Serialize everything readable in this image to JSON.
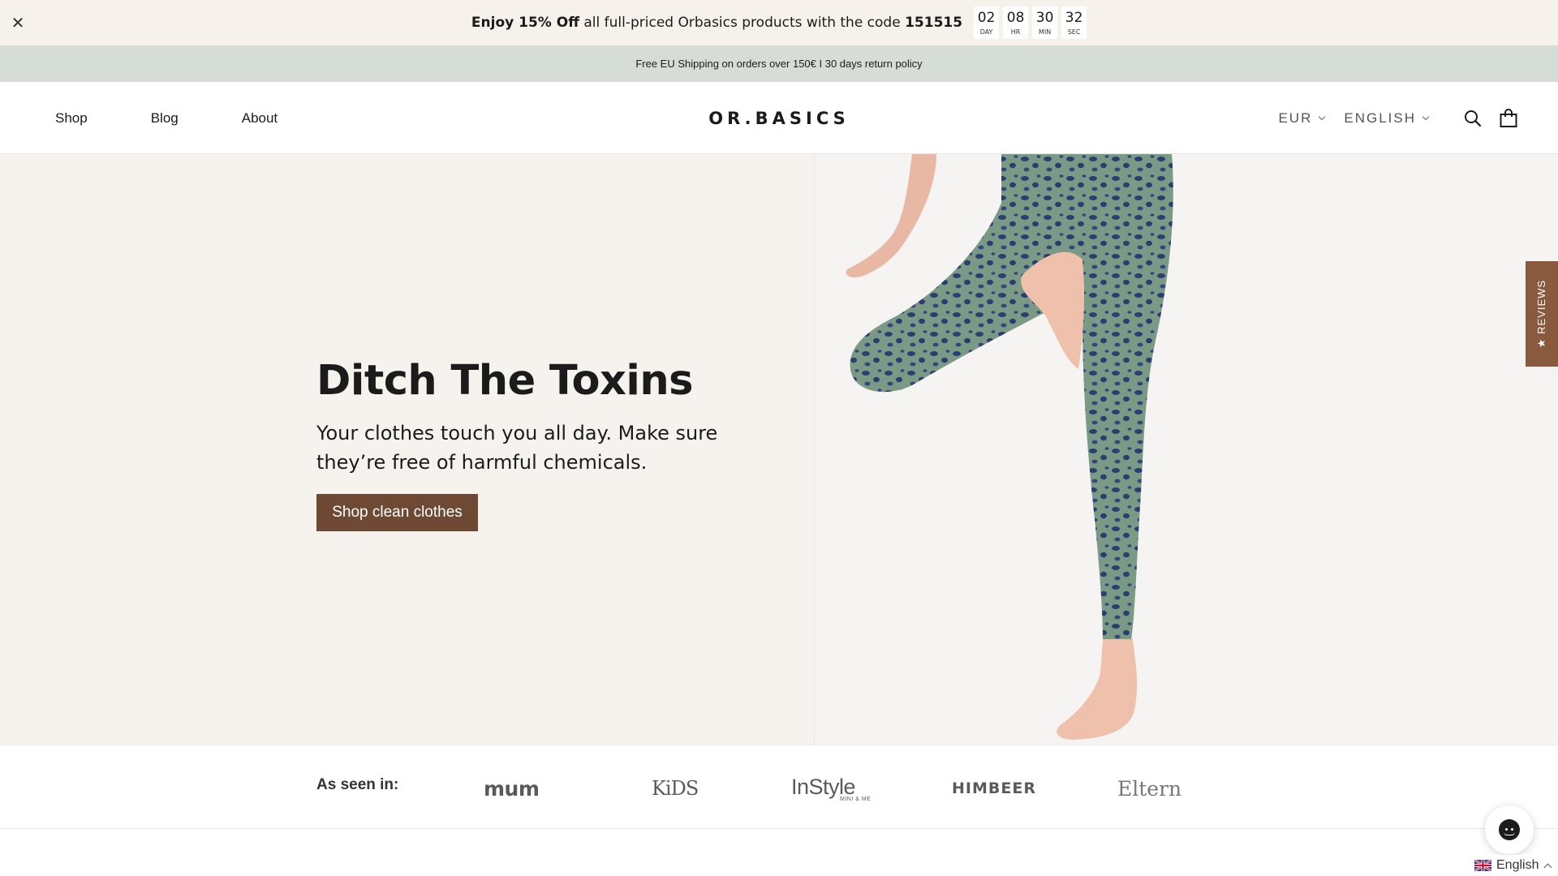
{
  "promo": {
    "text_bold_1": "Enjoy 15% Off",
    "text_mid": " all full-priced Orbasics products with the code ",
    "code": "151515",
    "countdown": [
      {
        "value": "02",
        "label": "DAY"
      },
      {
        "value": "08",
        "label": "HR"
      },
      {
        "value": "30",
        "label": "MIN"
      },
      {
        "value": "32",
        "label": "SEC"
      }
    ]
  },
  "shipping": {
    "text": "Free EU Shipping on orders over 150€ I 30 days return policy"
  },
  "header": {
    "nav": [
      "Shop",
      "Blog",
      "About"
    ],
    "logo": "OR.BASICS",
    "currency": "EUR",
    "language": "ENGLISH"
  },
  "hero": {
    "title": "Ditch The Toxins",
    "subtitle": "Your clothes touch you all day. Make sure they’re free of harmful chemicals.",
    "cta": "Shop clean clothes"
  },
  "reviews_tab": {
    "label": "★ REVIEWS"
  },
  "press": {
    "label": "As seen in:",
    "logos": [
      "mum",
      "KiDS",
      "InStyle",
      "HIMBEER",
      "Eltern"
    ],
    "instyle_sub": "MINI & ME"
  },
  "language_switch": {
    "label": "English"
  },
  "colors": {
    "promo_bg": "#f7f1ec",
    "shipping_bg": "#d6ddd8",
    "hero_bg": "#f6f3ef",
    "cta_bg": "#6e4a35",
    "reviews_bg": "#8a5a3f"
  }
}
